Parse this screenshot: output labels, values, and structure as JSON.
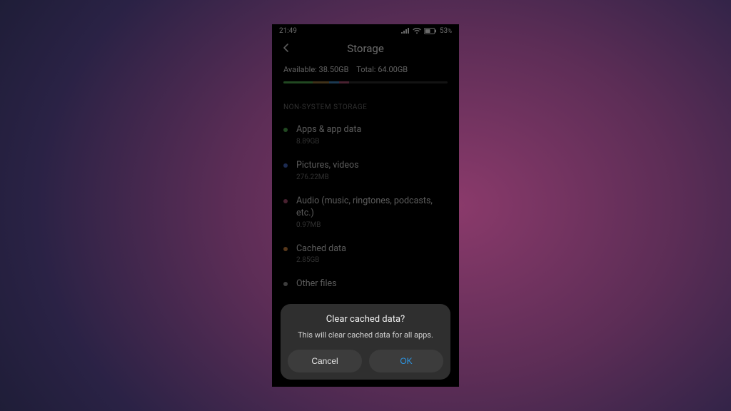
{
  "status": {
    "time": "21:49",
    "battery_text": "53"
  },
  "page": {
    "title": "Storage",
    "available_label": "Available: 38.50GB",
    "total_label": "Total: 64.00GB",
    "section_label": "NON-SYSTEM STORAGE"
  },
  "segments": [
    {
      "color": "#4aa04a",
      "pct": 18
    },
    {
      "color": "#8d6e38",
      "pct": 10
    },
    {
      "color": "#3e7fb3",
      "pct": 6
    },
    {
      "color": "#a3496b",
      "pct": 6
    }
  ],
  "items": [
    {
      "dot": "#4aa04a",
      "title": "Apps & app data",
      "sub": "8.89GB"
    },
    {
      "dot": "#3e5fb3",
      "title": "Pictures, videos",
      "sub": "276.22MB"
    },
    {
      "dot": "#a3496b",
      "title": "Audio (music, ringtones, podcasts, etc.)",
      "sub": "0.97MB"
    },
    {
      "dot": "#c07a3a",
      "title": "Cached data",
      "sub": "2.85GB"
    },
    {
      "dot": "#888888",
      "title": "Other files",
      "sub": ""
    }
  ],
  "dialog": {
    "title": "Clear cached data?",
    "message": "This will clear cached data for all apps.",
    "cancel": "Cancel",
    "ok": "OK"
  }
}
